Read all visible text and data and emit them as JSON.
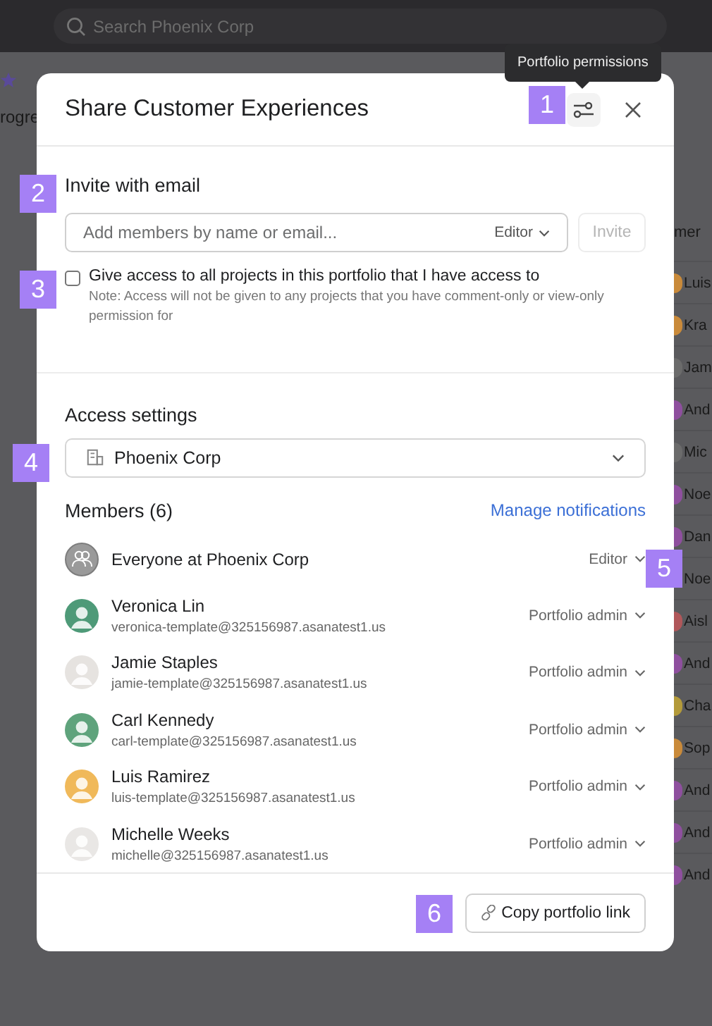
{
  "app_background": {
    "search": {
      "placeholder": "Search Phoenix Corp"
    },
    "left_text": "rogre",
    "column_header": "mer",
    "column_items": [
      {
        "text": "Luis",
        "color": "#c98a3a"
      },
      {
        "text": "Kra",
        "color": "#c98a3a"
      },
      {
        "text": "Jam",
        "color": "#6b6b6b"
      },
      {
        "text": "And",
        "color": "#8e4f9e"
      },
      {
        "text": "Mic",
        "color": "#6b6b6b"
      },
      {
        "text": "Noe",
        "color": "#8e4f9e"
      },
      {
        "text": "Dan",
        "color": "#8e4f9e"
      },
      {
        "text": "Noe"
      },
      {
        "text": "Aisl",
        "color": "#b0575a"
      },
      {
        "text": "And",
        "color": "#8e4f9e"
      },
      {
        "text": "Cha",
        "color": "#b39a3a"
      },
      {
        "text": "Sop",
        "color": "#c98a3a"
      },
      {
        "text": "And",
        "color": "#8e4f9e"
      },
      {
        "text": "And",
        "color": "#8e4f9e"
      },
      {
        "text": "And",
        "color": "#8e4f9e"
      }
    ]
  },
  "tooltip": "Portfolio permissions",
  "dialog": {
    "title": "Share Customer Experiences",
    "invite": {
      "heading": "Invite with email",
      "placeholder": "Add members by name or email...",
      "role": "Editor",
      "button": "Invite",
      "button_disabled": true
    },
    "access_all": {
      "label": "Give access to all projects in this portfolio that I have access to",
      "checked": false,
      "note": "Note: Access will not be given to any projects that you have comment-only or view-only permission for"
    },
    "access_settings": {
      "heading": "Access settings",
      "value": "Phoenix Corp"
    },
    "members": {
      "heading": "Members (6)",
      "link": "Manage notifications",
      "everyone": {
        "name": "Everyone at Phoenix Corp",
        "role": "Editor"
      },
      "list": [
        {
          "name": "Veronica Lin",
          "email": "veronica-template@325156987.asanatest1.us",
          "role": "Portfolio admin",
          "color": "#4e9a78"
        },
        {
          "name": "Jamie Staples",
          "email": "jamie-template@325156987.asanatest1.us",
          "role": "Portfolio admin",
          "color": "#e6e3e0"
        },
        {
          "name": "Carl Kennedy",
          "email": "carl-template@325156987.asanatest1.us",
          "role": "Portfolio admin",
          "color": "#5fa37c"
        },
        {
          "name": "Luis Ramirez",
          "email": "luis-template@325156987.asanatest1.us",
          "role": "Portfolio admin",
          "color": "#f0b95a"
        },
        {
          "name": "Michelle Weeks",
          "email": "michelle@325156987.asanatest1.us",
          "role": "Portfolio admin",
          "color": "#e9e7e5"
        }
      ]
    },
    "footer_button": "Copy portfolio link"
  },
  "annotations": [
    "1",
    "2",
    "3",
    "4",
    "5",
    "6"
  ]
}
